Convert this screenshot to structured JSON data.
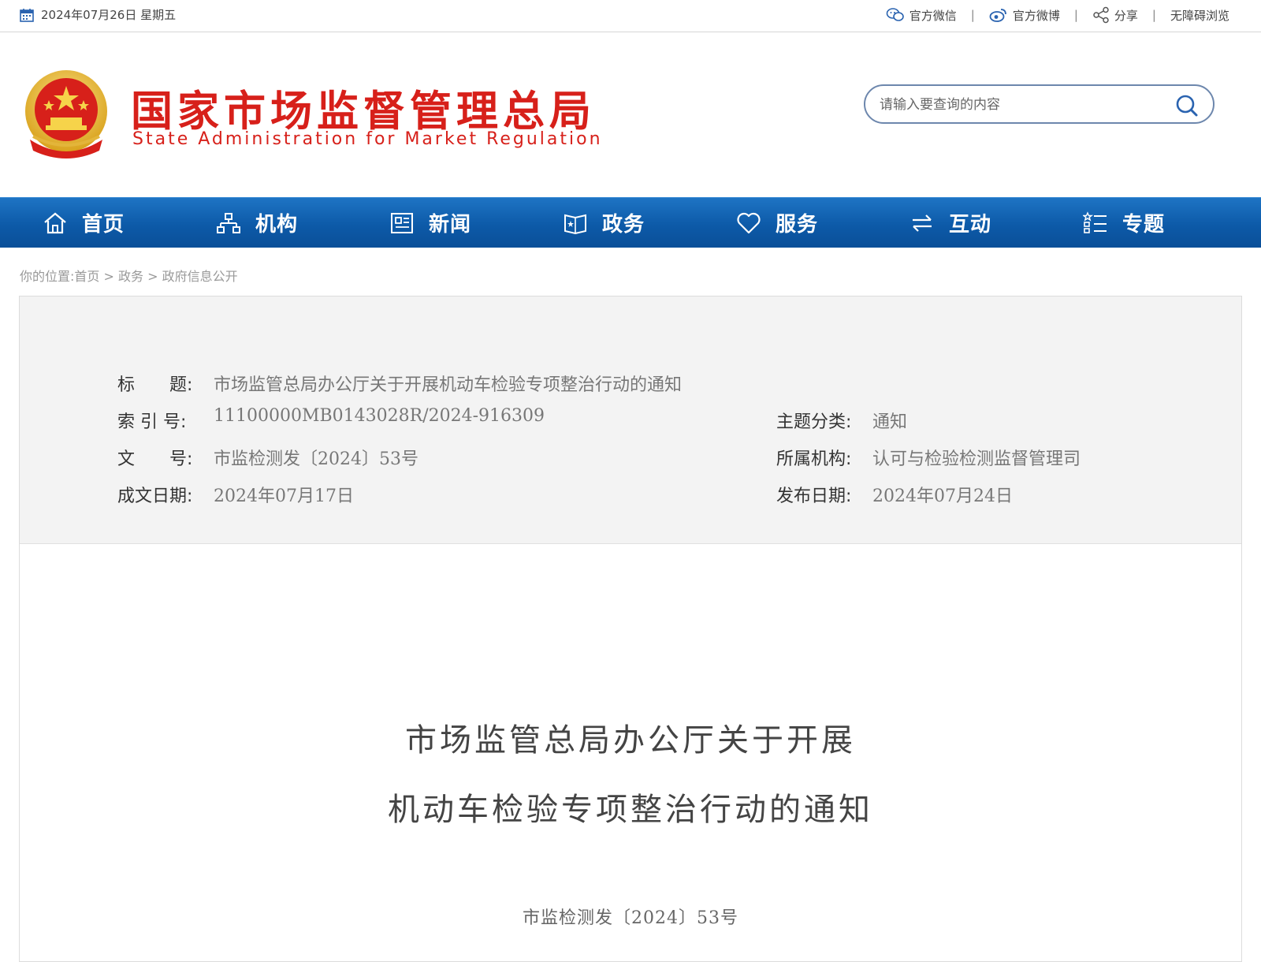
{
  "topbar": {
    "date": "2024年07月26日 星期五",
    "links": [
      {
        "label": "官方微信",
        "icon": "wechat-icon"
      },
      {
        "label": "官方微博",
        "icon": "weibo-icon"
      },
      {
        "label": "分享",
        "icon": "share-icon"
      },
      {
        "label": "无障碍浏览",
        "icon": ""
      }
    ]
  },
  "header": {
    "title_cn": "国家市场监督管理总局",
    "title_en": "State Administration for Market Regulation",
    "brand_color": "#d7201a"
  },
  "search": {
    "placeholder": "请输入要查询的内容"
  },
  "nav": {
    "items": [
      {
        "label": "首页",
        "icon": "home-icon"
      },
      {
        "label": "机构",
        "icon": "org-chart-icon"
      },
      {
        "label": "新闻",
        "icon": "news-icon"
      },
      {
        "label": "政务",
        "icon": "government-book-icon"
      },
      {
        "label": "服务",
        "icon": "heart-icon"
      },
      {
        "label": "互动",
        "icon": "exchange-arrows-icon"
      },
      {
        "label": "专题",
        "icon": "topics-list-icon"
      }
    ],
    "color": "#0d5aa8"
  },
  "breadcrumb": {
    "prefix": "你的位置:",
    "items": [
      "首页",
      "政务",
      "政府信息公开"
    ],
    "separator": " > "
  },
  "meta": {
    "title_label": "标　　题:",
    "title_value": "市场监管总局办公厅关于开展机动车检验专项整治行动的通知",
    "index_label": "索 引 号:",
    "index_value": "11100000MB0143028R/2024-916309",
    "category_label": "主题分类:",
    "category_value": "通知",
    "docno_label": "文　　号:",
    "docno_value": "市监检测发〔2024〕53号",
    "org_label": "所属机构:",
    "org_value": "认可与检验检测监督管理司",
    "written_label": "成文日期:",
    "written_value": "2024年07月17日",
    "published_label": "发布日期:",
    "published_value": "2024年07月24日"
  },
  "document": {
    "title_line1": "市场监管总局办公厅关于开展",
    "title_line2": "机动车检验专项整治行动的通知",
    "number": "市监检测发〔2024〕53号"
  }
}
